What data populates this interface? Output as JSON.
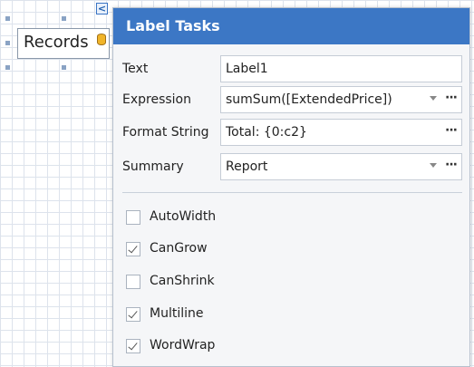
{
  "designer": {
    "label_text": "Records",
    "smart_tag_glyph": "<",
    "database_icon": "database-icon",
    "accent_color": "#3c77c5"
  },
  "panel": {
    "title": "Label Tasks",
    "fields": {
      "text": {
        "label": "Text",
        "value": "Label1"
      },
      "expression": {
        "label": "Expression",
        "value": "sumSum([ExtendedPrice])"
      },
      "format_string": {
        "label": "Format String",
        "value": "Total: {0:c2}"
      },
      "summary": {
        "label": "Summary",
        "value": "Report"
      }
    },
    "ellipsis": "···",
    "checkboxes": {
      "autowidth": {
        "label": "AutoWidth",
        "checked": false
      },
      "cangrow": {
        "label": "CanGrow",
        "checked": true
      },
      "canshrink": {
        "label": "CanShrink",
        "checked": false
      },
      "multiline": {
        "label": "Multiline",
        "checked": true
      },
      "wordwrap": {
        "label": "WordWrap",
        "checked": true
      }
    }
  }
}
